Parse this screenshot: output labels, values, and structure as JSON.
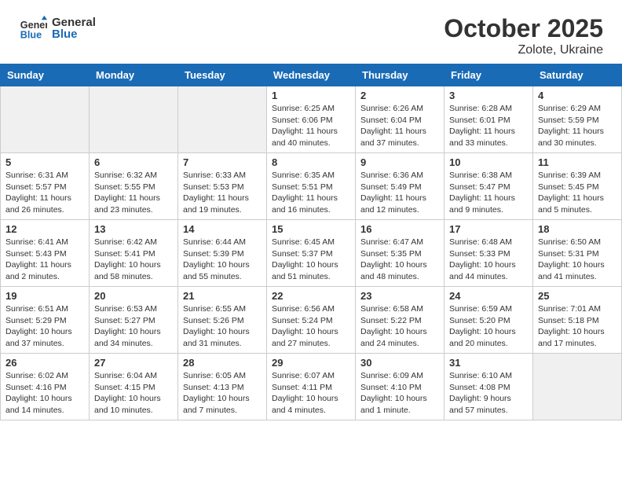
{
  "header": {
    "logo_general": "General",
    "logo_blue": "Blue",
    "month": "October 2025",
    "location": "Zolote, Ukraine"
  },
  "days_of_week": [
    "Sunday",
    "Monday",
    "Tuesday",
    "Wednesday",
    "Thursday",
    "Friday",
    "Saturday"
  ],
  "weeks": [
    [
      {
        "day": "",
        "detail": ""
      },
      {
        "day": "",
        "detail": ""
      },
      {
        "day": "",
        "detail": ""
      },
      {
        "day": "1",
        "detail": "Sunrise: 6:25 AM\nSunset: 6:06 PM\nDaylight: 11 hours\nand 40 minutes."
      },
      {
        "day": "2",
        "detail": "Sunrise: 6:26 AM\nSunset: 6:04 PM\nDaylight: 11 hours\nand 37 minutes."
      },
      {
        "day": "3",
        "detail": "Sunrise: 6:28 AM\nSunset: 6:01 PM\nDaylight: 11 hours\nand 33 minutes."
      },
      {
        "day": "4",
        "detail": "Sunrise: 6:29 AM\nSunset: 5:59 PM\nDaylight: 11 hours\nand 30 minutes."
      }
    ],
    [
      {
        "day": "5",
        "detail": "Sunrise: 6:31 AM\nSunset: 5:57 PM\nDaylight: 11 hours\nand 26 minutes."
      },
      {
        "day": "6",
        "detail": "Sunrise: 6:32 AM\nSunset: 5:55 PM\nDaylight: 11 hours\nand 23 minutes."
      },
      {
        "day": "7",
        "detail": "Sunrise: 6:33 AM\nSunset: 5:53 PM\nDaylight: 11 hours\nand 19 minutes."
      },
      {
        "day": "8",
        "detail": "Sunrise: 6:35 AM\nSunset: 5:51 PM\nDaylight: 11 hours\nand 16 minutes."
      },
      {
        "day": "9",
        "detail": "Sunrise: 6:36 AM\nSunset: 5:49 PM\nDaylight: 11 hours\nand 12 minutes."
      },
      {
        "day": "10",
        "detail": "Sunrise: 6:38 AM\nSunset: 5:47 PM\nDaylight: 11 hours\nand 9 minutes."
      },
      {
        "day": "11",
        "detail": "Sunrise: 6:39 AM\nSunset: 5:45 PM\nDaylight: 11 hours\nand 5 minutes."
      }
    ],
    [
      {
        "day": "12",
        "detail": "Sunrise: 6:41 AM\nSunset: 5:43 PM\nDaylight: 11 hours\nand 2 minutes."
      },
      {
        "day": "13",
        "detail": "Sunrise: 6:42 AM\nSunset: 5:41 PM\nDaylight: 10 hours\nand 58 minutes."
      },
      {
        "day": "14",
        "detail": "Sunrise: 6:44 AM\nSunset: 5:39 PM\nDaylight: 10 hours\nand 55 minutes."
      },
      {
        "day": "15",
        "detail": "Sunrise: 6:45 AM\nSunset: 5:37 PM\nDaylight: 10 hours\nand 51 minutes."
      },
      {
        "day": "16",
        "detail": "Sunrise: 6:47 AM\nSunset: 5:35 PM\nDaylight: 10 hours\nand 48 minutes."
      },
      {
        "day": "17",
        "detail": "Sunrise: 6:48 AM\nSunset: 5:33 PM\nDaylight: 10 hours\nand 44 minutes."
      },
      {
        "day": "18",
        "detail": "Sunrise: 6:50 AM\nSunset: 5:31 PM\nDaylight: 10 hours\nand 41 minutes."
      }
    ],
    [
      {
        "day": "19",
        "detail": "Sunrise: 6:51 AM\nSunset: 5:29 PM\nDaylight: 10 hours\nand 37 minutes."
      },
      {
        "day": "20",
        "detail": "Sunrise: 6:53 AM\nSunset: 5:27 PM\nDaylight: 10 hours\nand 34 minutes."
      },
      {
        "day": "21",
        "detail": "Sunrise: 6:55 AM\nSunset: 5:26 PM\nDaylight: 10 hours\nand 31 minutes."
      },
      {
        "day": "22",
        "detail": "Sunrise: 6:56 AM\nSunset: 5:24 PM\nDaylight: 10 hours\nand 27 minutes."
      },
      {
        "day": "23",
        "detail": "Sunrise: 6:58 AM\nSunset: 5:22 PM\nDaylight: 10 hours\nand 24 minutes."
      },
      {
        "day": "24",
        "detail": "Sunrise: 6:59 AM\nSunset: 5:20 PM\nDaylight: 10 hours\nand 20 minutes."
      },
      {
        "day": "25",
        "detail": "Sunrise: 7:01 AM\nSunset: 5:18 PM\nDaylight: 10 hours\nand 17 minutes."
      }
    ],
    [
      {
        "day": "26",
        "detail": "Sunrise: 6:02 AM\nSunset: 4:16 PM\nDaylight: 10 hours\nand 14 minutes."
      },
      {
        "day": "27",
        "detail": "Sunrise: 6:04 AM\nSunset: 4:15 PM\nDaylight: 10 hours\nand 10 minutes."
      },
      {
        "day": "28",
        "detail": "Sunrise: 6:05 AM\nSunset: 4:13 PM\nDaylight: 10 hours\nand 7 minutes."
      },
      {
        "day": "29",
        "detail": "Sunrise: 6:07 AM\nSunset: 4:11 PM\nDaylight: 10 hours\nand 4 minutes."
      },
      {
        "day": "30",
        "detail": "Sunrise: 6:09 AM\nSunset: 4:10 PM\nDaylight: 10 hours\nand 1 minute."
      },
      {
        "day": "31",
        "detail": "Sunrise: 6:10 AM\nSunset: 4:08 PM\nDaylight: 9 hours\nand 57 minutes."
      },
      {
        "day": "",
        "detail": ""
      }
    ]
  ]
}
